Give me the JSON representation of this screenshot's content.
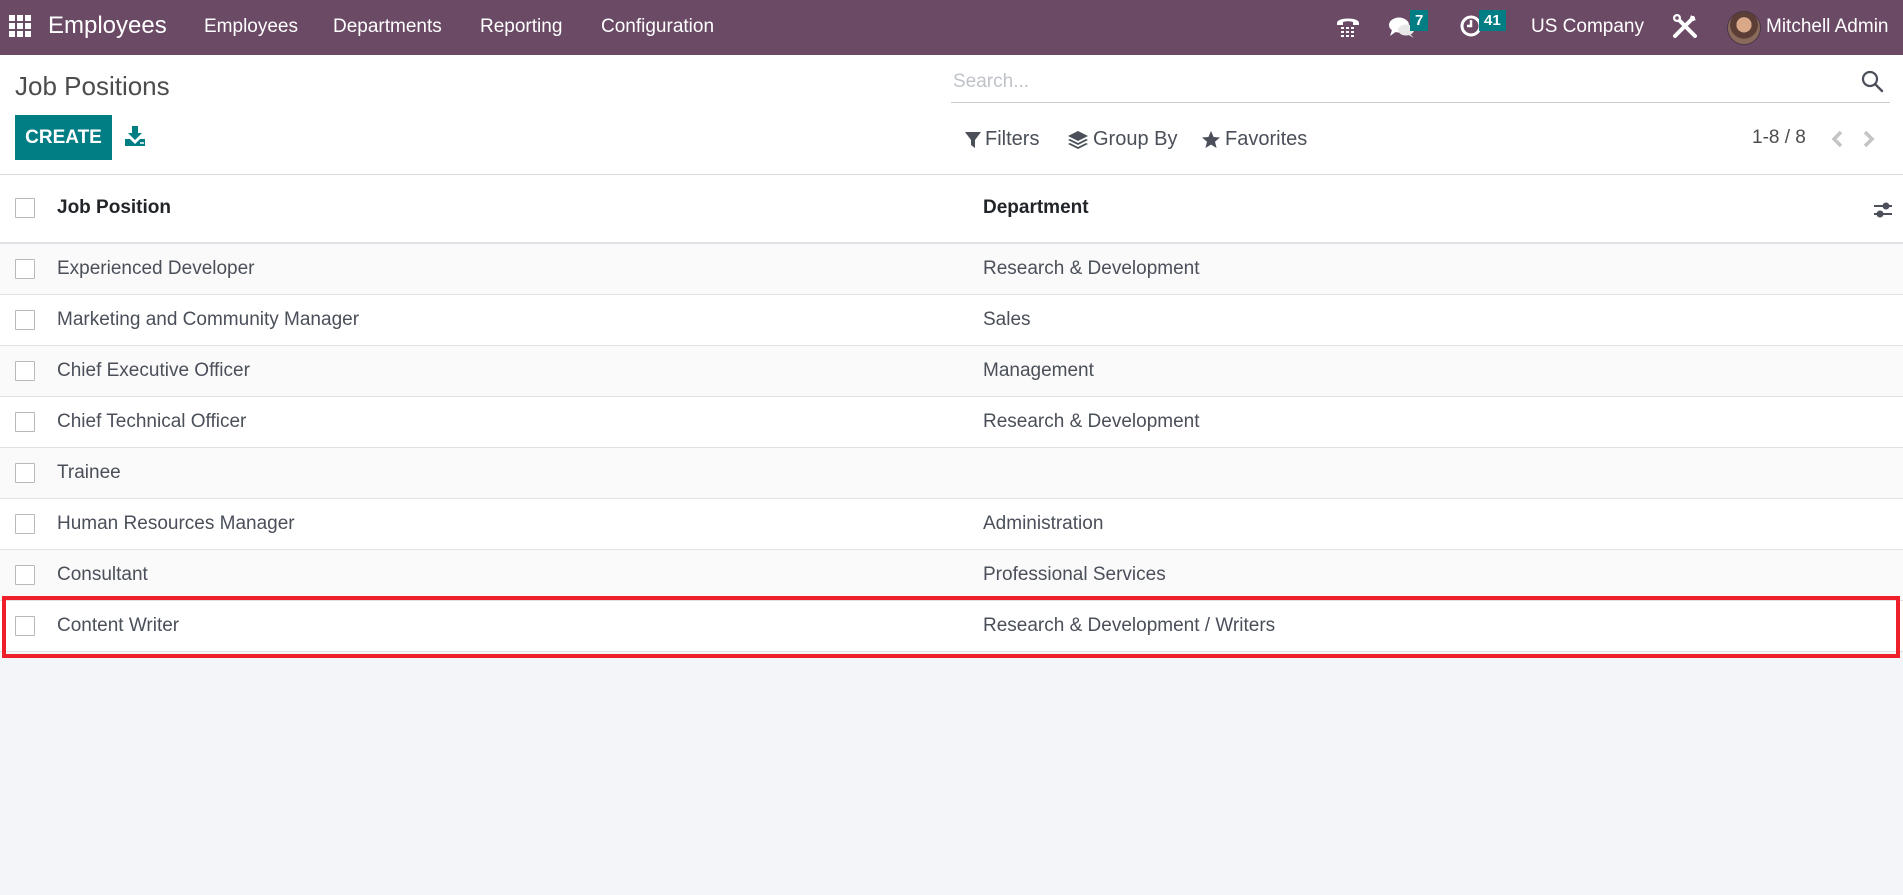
{
  "navbar": {
    "app_name": "Employees",
    "menu": [
      "Employees",
      "Departments",
      "Reporting",
      "Configuration"
    ],
    "icons": {
      "apps": "apps-grid-icon",
      "phone": "phone-icon",
      "chat": "chat-icon",
      "activity": "clock-icon",
      "debug": "tools-icon"
    },
    "chat_count": "7",
    "activity_count": "41",
    "company": "US Company",
    "user": "Mitchell Admin"
  },
  "control_panel": {
    "title": "Job Positions",
    "create_label": "CREATE",
    "search_placeholder": "Search...",
    "filters_label": "Filters",
    "group_by_label": "Group By",
    "favorites_label": "Favorites",
    "pager": "1-8 / 8"
  },
  "table": {
    "columns": [
      "Job Position",
      "Department"
    ],
    "rows": [
      {
        "position": "Experienced Developer",
        "department": "Research & Development"
      },
      {
        "position": "Marketing and Community Manager",
        "department": "Sales"
      },
      {
        "position": "Chief Executive Officer",
        "department": "Management"
      },
      {
        "position": "Chief Technical Officer",
        "department": "Research & Development"
      },
      {
        "position": "Trainee",
        "department": ""
      },
      {
        "position": "Human Resources Manager",
        "department": "Administration"
      },
      {
        "position": "Consultant",
        "department": "Professional Services"
      },
      {
        "position": "Content Writer",
        "department": "Research & Development / Writers"
      }
    ],
    "highlighted_row": 7
  },
  "colors": {
    "navbar": "#6a4a64",
    "primary": "#017e84",
    "highlight": "#ef1f2a"
  }
}
